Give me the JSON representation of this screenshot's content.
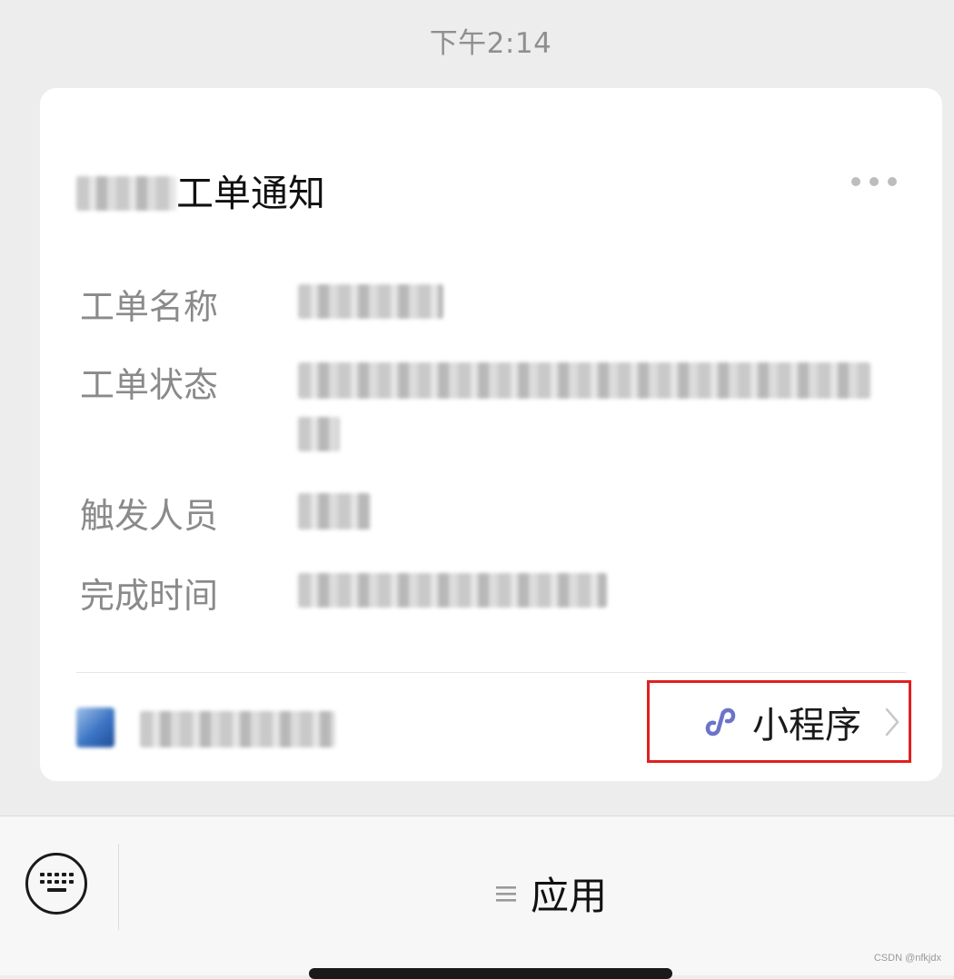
{
  "chat": {
    "timestamp": "下午2:14"
  },
  "card": {
    "title_visible": "工单通知",
    "fields": [
      {
        "label": "工单名称"
      },
      {
        "label": "工单状态"
      },
      {
        "label": "触发人员"
      },
      {
        "label": "完成时间"
      }
    ],
    "footer": {
      "mini_program_label": "小程序"
    }
  },
  "input_bar": {
    "apps_label": "应用"
  },
  "watermark": "CSDN @nfkjdx",
  "colors": {
    "highlight_border": "#e02020",
    "mini_program_icon": "#6b74c9",
    "card_background": "#ffffff",
    "page_background": "#ededed"
  },
  "icons": {
    "more": "more-dots-icon",
    "mini_program": "mini-program-icon",
    "chevron": "chevron-right-icon",
    "keyboard": "keyboard-icon",
    "menu": "menu-icon"
  }
}
